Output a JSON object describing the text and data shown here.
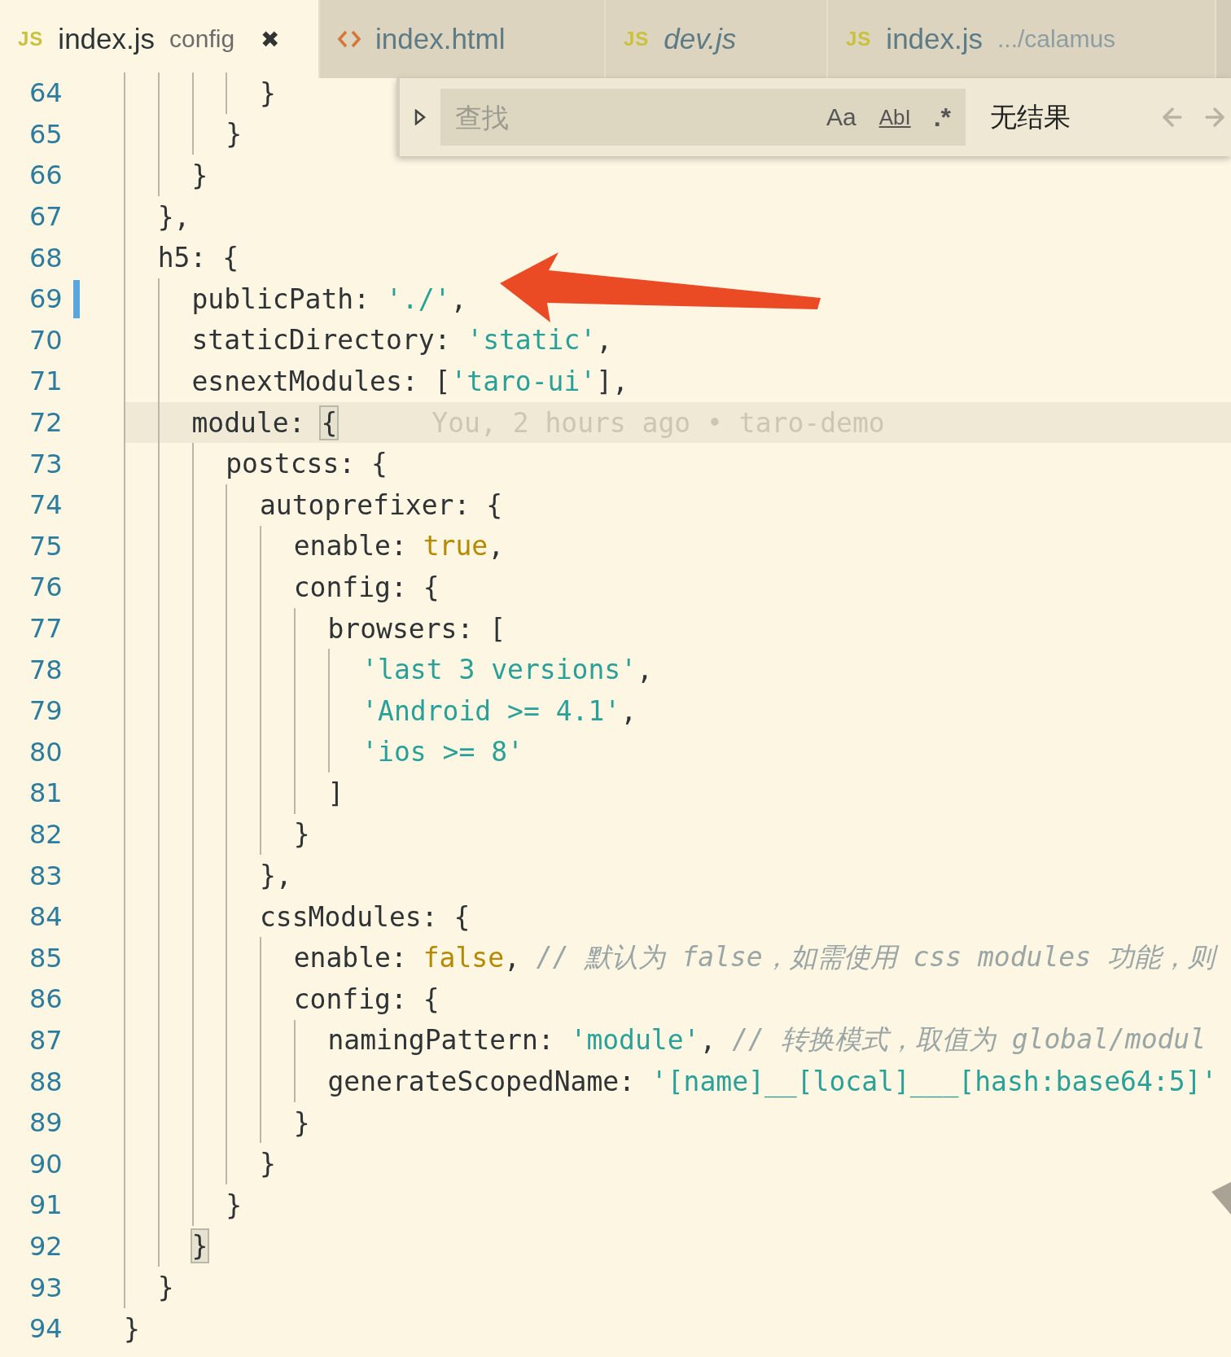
{
  "tabs": [
    {
      "icon": {
        "kind": "js",
        "text": "JS"
      },
      "label": "index.js",
      "description": "config",
      "selected": true,
      "italic": false,
      "close": "✖"
    },
    {
      "icon": {
        "kind": "html"
      },
      "label": "index.html",
      "selected": false,
      "italic": false
    },
    {
      "icon": {
        "kind": "js",
        "text": "JS"
      },
      "label": "dev.js",
      "selected": false,
      "italic": true
    },
    {
      "icon": {
        "kind": "js",
        "text": "JS"
      },
      "label": "index.js",
      "description": ".../calamus",
      "selected": false,
      "italic": false
    }
  ],
  "find_widget": {
    "expanded": false,
    "placeholder": "查找",
    "options": [
      {
        "kind": "case",
        "label": "Aa",
        "selected": false
      },
      {
        "kind": "word",
        "label": "AbI",
        "selected": false
      },
      {
        "kind": "regex",
        "label": ".*",
        "selected": false
      }
    ],
    "result": "无结果",
    "prev_disabled": true,
    "next_disabled": true
  },
  "lines": [
    {
      "number": "64",
      "current": false,
      "modified": false,
      "tokens": [
        {
          "kind": "plain",
          "text": "        }"
        }
      ]
    },
    {
      "number": "65",
      "current": false,
      "modified": false,
      "tokens": [
        {
          "kind": "plain",
          "text": "      }"
        }
      ]
    },
    {
      "number": "66",
      "current": false,
      "modified": false,
      "tokens": [
        {
          "kind": "plain",
          "text": "    }"
        }
      ]
    },
    {
      "number": "67",
      "current": false,
      "modified": false,
      "tokens": [
        {
          "kind": "plain",
          "text": "  },"
        }
      ]
    },
    {
      "number": "68",
      "current": false,
      "modified": false,
      "tokens": [
        {
          "kind": "plain",
          "text": "  h5: {"
        }
      ]
    },
    {
      "number": "69",
      "current": false,
      "modified": true,
      "tokens": [
        {
          "kind": "plain",
          "text": "    publicPath: "
        },
        {
          "kind": "string",
          "text": "'./'"
        },
        {
          "kind": "plain",
          "text": ","
        }
      ]
    },
    {
      "number": "70",
      "current": false,
      "modified": false,
      "tokens": [
        {
          "kind": "plain",
          "text": "    staticDirectory: "
        },
        {
          "kind": "string",
          "text": "'static'"
        },
        {
          "kind": "plain",
          "text": ","
        }
      ]
    },
    {
      "number": "71",
      "current": false,
      "modified": false,
      "tokens": [
        {
          "kind": "plain",
          "text": "    esnextModules: ["
        },
        {
          "kind": "string",
          "text": "'taro-ui'"
        },
        {
          "kind": "plain",
          "text": "],"
        }
      ]
    },
    {
      "number": "72",
      "current": true,
      "modified": false,
      "tokens": [
        {
          "kind": "plain",
          "text": "    module: "
        },
        {
          "kind": "bracket",
          "text": "{"
        }
      ],
      "blame": "You, 2 hours ago • taro-demo"
    },
    {
      "number": "73",
      "current": false,
      "modified": false,
      "tokens": [
        {
          "kind": "plain",
          "text": "      postcss: {"
        }
      ]
    },
    {
      "number": "74",
      "current": false,
      "modified": false,
      "tokens": [
        {
          "kind": "plain",
          "text": "        autoprefixer: {"
        }
      ]
    },
    {
      "number": "75",
      "current": false,
      "modified": false,
      "tokens": [
        {
          "kind": "plain",
          "text": "          enable: "
        },
        {
          "kind": "keyword",
          "text": "true"
        },
        {
          "kind": "plain",
          "text": ","
        }
      ]
    },
    {
      "number": "76",
      "current": false,
      "modified": false,
      "tokens": [
        {
          "kind": "plain",
          "text": "          config: {"
        }
      ]
    },
    {
      "number": "77",
      "current": false,
      "modified": false,
      "tokens": [
        {
          "kind": "plain",
          "text": "            browsers: ["
        }
      ]
    },
    {
      "number": "78",
      "current": false,
      "modified": false,
      "tokens": [
        {
          "kind": "string",
          "text": "              'last 3 versions'"
        },
        {
          "kind": "plain",
          "text": ","
        }
      ]
    },
    {
      "number": "79",
      "current": false,
      "modified": false,
      "tokens": [
        {
          "kind": "string",
          "text": "              'Android >= 4.1'"
        },
        {
          "kind": "plain",
          "text": ","
        }
      ]
    },
    {
      "number": "80",
      "current": false,
      "modified": false,
      "tokens": [
        {
          "kind": "string",
          "text": "              'ios >= 8'"
        }
      ]
    },
    {
      "number": "81",
      "current": false,
      "modified": false,
      "tokens": [
        {
          "kind": "plain",
          "text": "            ]"
        }
      ]
    },
    {
      "number": "82",
      "current": false,
      "modified": false,
      "tokens": [
        {
          "kind": "plain",
          "text": "          }"
        }
      ]
    },
    {
      "number": "83",
      "current": false,
      "modified": false,
      "tokens": [
        {
          "kind": "plain",
          "text": "        },"
        }
      ]
    },
    {
      "number": "84",
      "current": false,
      "modified": false,
      "tokens": [
        {
          "kind": "plain",
          "text": "        cssModules: {"
        }
      ]
    },
    {
      "number": "85",
      "current": false,
      "modified": false,
      "tokens": [
        {
          "kind": "plain",
          "text": "          enable: "
        },
        {
          "kind": "keyword",
          "text": "false"
        },
        {
          "kind": "plain",
          "text": ", "
        },
        {
          "kind": "comment",
          "text": "// 默认为 false，如需使用 css modules 功能，则"
        }
      ]
    },
    {
      "number": "86",
      "current": false,
      "modified": false,
      "tokens": [
        {
          "kind": "plain",
          "text": "          config: {"
        }
      ]
    },
    {
      "number": "87",
      "current": false,
      "modified": false,
      "tokens": [
        {
          "kind": "plain",
          "text": "            namingPattern: "
        },
        {
          "kind": "string",
          "text": "'module'"
        },
        {
          "kind": "plain",
          "text": ", "
        },
        {
          "kind": "comment",
          "text": "// 转换模式，取值为 global/modul"
        }
      ]
    },
    {
      "number": "88",
      "current": false,
      "modified": false,
      "tokens": [
        {
          "kind": "plain",
          "text": "            generateScopedName: "
        },
        {
          "kind": "string",
          "text": "'[name]__[local]___[hash:base64:5]'"
        }
      ]
    },
    {
      "number": "89",
      "current": false,
      "modified": false,
      "tokens": [
        {
          "kind": "plain",
          "text": "          }"
        }
      ]
    },
    {
      "number": "90",
      "current": false,
      "modified": false,
      "tokens": [
        {
          "kind": "plain",
          "text": "        }"
        }
      ]
    },
    {
      "number": "91",
      "current": false,
      "modified": false,
      "tokens": [
        {
          "kind": "plain",
          "text": "      }"
        }
      ]
    },
    {
      "number": "92",
      "current": false,
      "modified": false,
      "tokens": [
        {
          "kind": "bracket",
          "text": "    }"
        }
      ]
    },
    {
      "number": "93",
      "current": false,
      "modified": false,
      "tokens": [
        {
          "kind": "plain",
          "text": "  }"
        }
      ]
    },
    {
      "number": "94",
      "current": false,
      "modified": false,
      "tokens": [
        {
          "kind": "plain",
          "text": "}"
        }
      ]
    }
  ]
}
